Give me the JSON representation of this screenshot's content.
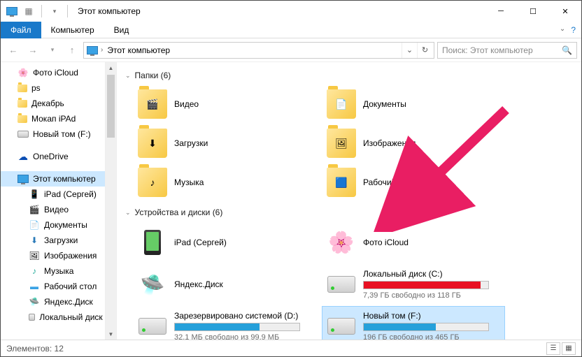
{
  "title": "Этот компьютер",
  "ribbon": {
    "file": "Файл",
    "tab1": "Компьютер",
    "tab2": "Вид"
  },
  "breadcrumb": {
    "location": "Этот компьютер"
  },
  "search": {
    "placeholder": "Поиск: Этот компьютер"
  },
  "sidebar": {
    "items": [
      {
        "label": "Фото iCloud",
        "icon": "photos"
      },
      {
        "label": "ps",
        "icon": "folder"
      },
      {
        "label": "Декабрь",
        "icon": "folder"
      },
      {
        "label": "Мокап iPAd",
        "icon": "folder"
      },
      {
        "label": "Новый том (F:)",
        "icon": "drive"
      },
      {
        "label": "OneDrive",
        "icon": "onedrive",
        "spaced": true
      },
      {
        "label": "Этот компьютер",
        "icon": "pc",
        "selected": true,
        "spaced": true
      },
      {
        "label": "iPad (Сергей)",
        "icon": "ipad",
        "nested": true
      },
      {
        "label": "Видео",
        "icon": "video",
        "nested": true
      },
      {
        "label": "Документы",
        "icon": "docs",
        "nested": true
      },
      {
        "label": "Загрузки",
        "icon": "downloads",
        "nested": true
      },
      {
        "label": "Изображения",
        "icon": "images",
        "nested": true
      },
      {
        "label": "Музыка",
        "icon": "music",
        "nested": true
      },
      {
        "label": "Рабочий стол",
        "icon": "desktop",
        "nested": true
      },
      {
        "label": "Яндекс.Диск",
        "icon": "yadisk",
        "nested": true
      },
      {
        "label": "Локальный диск (…",
        "icon": "drive",
        "nested": true
      }
    ]
  },
  "groups": {
    "folders": {
      "title": "Папки (6)"
    },
    "devices": {
      "title": "Устройства и диски (6)"
    }
  },
  "folders": [
    {
      "label": "Видео",
      "glyph": "🎬"
    },
    {
      "label": "Документы",
      "glyph": "📄"
    },
    {
      "label": "Загрузки",
      "glyph": "⬇"
    },
    {
      "label": "Изображения",
      "glyph": "🖼"
    },
    {
      "label": "Музыка",
      "glyph": "♪"
    },
    {
      "label": "Рабочий стол",
      "glyph": "🟦"
    }
  ],
  "devices": [
    {
      "label": "iPad (Сергей)",
      "icon": "ipad"
    },
    {
      "label": "Фото iCloud",
      "icon": "photos"
    },
    {
      "label": "Яндекс.Диск",
      "icon": "yadisk"
    },
    {
      "label": "Локальный диск (C:)",
      "icon": "drive",
      "sub": "7,39 ГБ свободно из 118 ГБ",
      "fill": 94,
      "red": true
    },
    {
      "label": "Зарезервировано системой (D:)",
      "icon": "drive",
      "sub": "32,1 МБ свободно из 99,9 МБ",
      "fill": 68
    },
    {
      "label": "Новый том (F:)",
      "icon": "drive",
      "sub": "196 ГБ свободно из 465 ГБ",
      "fill": 58,
      "selected": true
    }
  ],
  "statusbar": {
    "count": "Элементов: 12"
  }
}
